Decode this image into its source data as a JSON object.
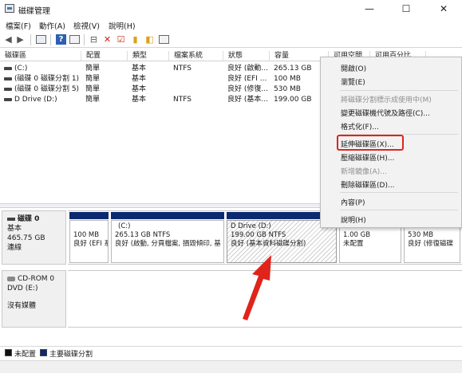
{
  "window": {
    "title": "磁碟管理",
    "buttons": {
      "minimize": "—",
      "maximize": "☐",
      "close": "✕"
    }
  },
  "menubar": [
    "檔案(F)",
    "動作(A)",
    "檢視(V)",
    "說明(H)"
  ],
  "table": {
    "headers": [
      "磁碟區",
      "配置",
      "類型",
      "檔案系統",
      "狀態",
      "容量",
      "可用空間",
      "可用百分比"
    ],
    "rows": [
      [
        "(C:)",
        "簡單",
        "基本",
        "NTFS",
        "良好 (啟動...",
        "265.13 GB"
      ],
      [
        "(磁碟 0 磁碟分割 1)",
        "簡單",
        "基本",
        "",
        "良好 (EFI ...",
        "100 MB"
      ],
      [
        "(磁碟 0 磁碟分割 5)",
        "簡單",
        "基本",
        "",
        "良好 (修復...",
        "530 MB"
      ],
      [
        "D Drive (D:)",
        "簡單",
        "基本",
        "NTFS",
        "良好 (基本...",
        "199.00 GB"
      ]
    ]
  },
  "disks": [
    {
      "name": "磁碟 0",
      "type": "基本",
      "size": "465.75 GB",
      "status": "連線",
      "partitions": [
        {
          "line1": "",
          "line2": "100 MB",
          "line3": "良好 (EFI 系"
        },
        {
          "line1": "(C:)",
          "line2": "265.13 GB NTFS",
          "line3": "良好 (啟動, 分頁檔案, 損毀傾印, 基"
        },
        {
          "line1": "D Drive  (D:)",
          "line2": "199.00 GB NTFS",
          "line3": "良好 (基本資料磁碟分割)"
        },
        {
          "line1": "",
          "line2": "1.00 GB",
          "line3": "未配置"
        },
        {
          "line1": "",
          "line2": "530 MB",
          "line3": "良好 (修復磁碟"
        }
      ]
    },
    {
      "name": "CD-ROM 0",
      "type": "DVD (E:)",
      "status": "沒有媒體"
    }
  ],
  "legend": {
    "unallocated": "未配置",
    "primary": "主要磁碟分割"
  },
  "context_menu": {
    "items": [
      {
        "label": "開啟(O)",
        "enabled": true
      },
      {
        "label": "瀏覽(E)",
        "enabled": true
      },
      {
        "label": "將磁碟分割標示成使用中(M)",
        "enabled": false
      },
      {
        "label": "變更磁碟機代號及路徑(C)...",
        "enabled": true
      },
      {
        "label": "格式化(F)...",
        "enabled": true
      },
      {
        "label": "延伸磁碟區(X)...",
        "enabled": true,
        "highlighted": true
      },
      {
        "label": "壓縮磁碟區(H)...",
        "enabled": true
      },
      {
        "label": "新增鏡像(A)...",
        "enabled": false
      },
      {
        "label": "刪除磁碟區(D)...",
        "enabled": true
      },
      {
        "label": "內容(P)",
        "enabled": true
      },
      {
        "label": "說明(H)",
        "enabled": true
      }
    ]
  },
  "colors": {
    "primary_partition": "#0b2a6f",
    "unallocated": "#111111",
    "highlight_box": "#e0241b",
    "arrow": "#e0241b"
  }
}
